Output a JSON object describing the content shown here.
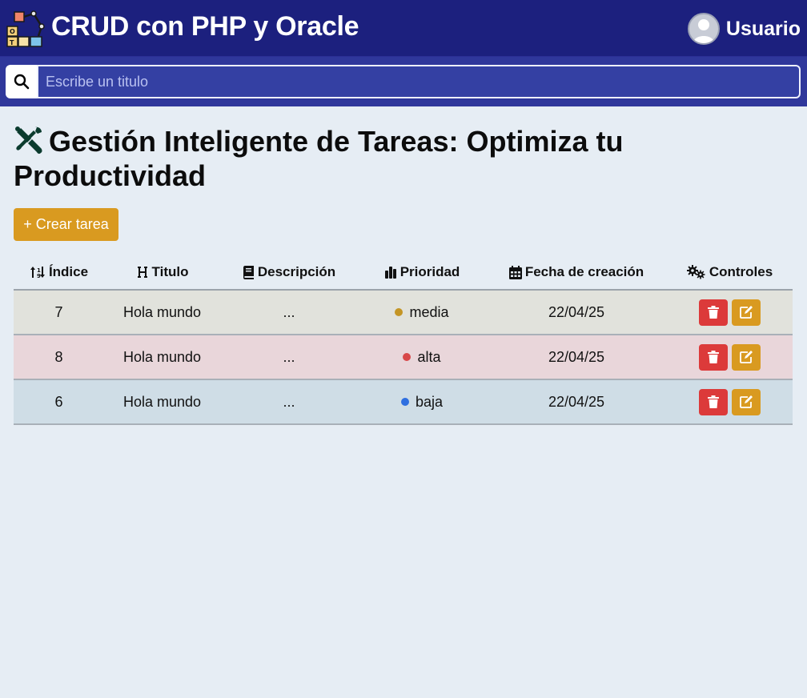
{
  "header": {
    "title": "CRUD con PHP y Oracle",
    "user": "Usuario"
  },
  "search": {
    "placeholder": "Escribe un titulo"
  },
  "page": {
    "title": "Gestión Inteligente de Tareas: Optimiza tu Productividad",
    "create_button": "+ Crear tarea"
  },
  "table": {
    "headers": {
      "index": "Índice",
      "title": "Titulo",
      "description": "Descripción",
      "priority": "Prioridad",
      "date": "Fecha de creación",
      "controls": "Controles"
    },
    "rows": [
      {
        "index": "7",
        "title": "Hola mundo",
        "description": "...",
        "priority": "media",
        "date": "22/04/25"
      },
      {
        "index": "8",
        "title": "Hola mundo",
        "description": "...",
        "priority": "alta",
        "date": "22/04/25"
      },
      {
        "index": "6",
        "title": "Hola mundo",
        "description": "...",
        "priority": "baja",
        "date": "22/04/25"
      }
    ]
  },
  "colors": {
    "header_bg": "#1c207e",
    "search_bg": "#2f379b",
    "page_bg": "#e6edf4",
    "accent": "#d99a20",
    "danger": "#dc3a3a",
    "row_media": "#e1e2dc",
    "row_alta": "#e9d6da",
    "row_baja": "#cfdde6",
    "dot_media": "#c49525",
    "dot_alta": "#d84849",
    "dot_baja": "#2f6fe0"
  }
}
